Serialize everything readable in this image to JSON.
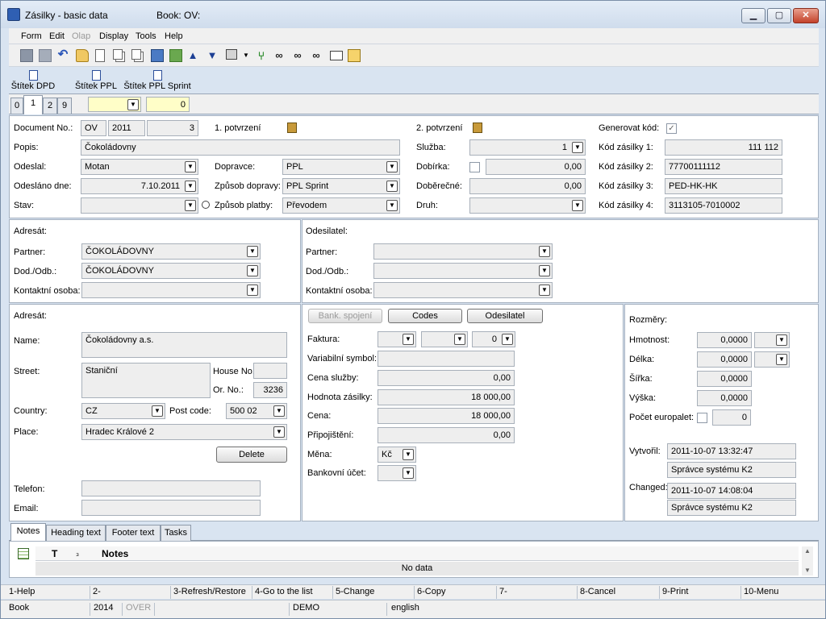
{
  "window": {
    "title": "Zásilky - basic data",
    "book_label": "Book: OV:",
    "minimize": "▁",
    "maximize": "▢",
    "close": "✕"
  },
  "menu": [
    "Form",
    "Edit",
    "Olap",
    "Display",
    "Tools",
    "Help"
  ],
  "toolbar_icons": [
    "save-icon",
    "save-all-icon",
    "undo-icon",
    "open-folder-icon",
    "new-document-icon",
    "copy-icon",
    "paste-icon",
    "book-icon",
    "stack-icon",
    "arrow-up-icon",
    "arrow-down-icon",
    "select-icon",
    "dropdown-icon",
    "fork-icon",
    "binoculars-icon",
    "binoculars-filter-icon",
    "binoculars-settings-icon",
    "mail-icon",
    "edit-icon"
  ],
  "print_buttons": [
    "Štítek DPD",
    "Štítek PPL",
    "Štítek PPL Sprint"
  ],
  "top_tabs": {
    "tabs": [
      "0",
      "1",
      "2",
      "9"
    ],
    "active": "1",
    "counter": "0"
  },
  "header": {
    "document_no_label": "Document No.:",
    "doc_prefix": "OV",
    "doc_year": "2011",
    "doc_number": "3",
    "potvrzeni1_label": "1. potvrzení",
    "potvrzeni2_label": "2. potvrzení",
    "generovat_kod_label": "Generovat kód:",
    "generovat_kod_checked": "✓",
    "popis_label": "Popis:",
    "popis_value": "Čokoládovny",
    "sluzba_label": "Služba:",
    "sluzba_value": "1",
    "kod1_label": "Kód zásilky 1:",
    "kod1_value": "111 112",
    "odeslal_label": "Odeslal:",
    "odeslal_value": "Motan",
    "dopravce_label": "Dopravce:",
    "dopravce_value": "PPL",
    "dobirka_label": "Dobírka:",
    "dobirka_value": "0,00",
    "kod2_label": "Kód zásilky 2:",
    "kod2_value": "77700111112",
    "odeslano_label": "Odesláno dne:",
    "odeslano_value": "7.10.2011",
    "zpusob_dopravy_label": "Způsob dopravy:",
    "zpusob_dopravy_value": "PPL Sprint",
    "doberecne_label": "Doběrečné:",
    "doberecne_value": "0,00",
    "kod3_label": "Kód zásilky 3:",
    "kod3_value": "PED-HK-HK",
    "stav_label": "Stav:",
    "stav_value": "",
    "zpusob_platby_label": "Způsob platby:",
    "zpusob_platby_value": "Převodem",
    "druh_label": "Druh:",
    "druh_value": "",
    "kod4_label": "Kód zásilky 4:",
    "kod4_value": "3113105-7010002"
  },
  "adresat": {
    "title": "Adresát:",
    "partner_label": "Partner:",
    "partner_value": "ČOKOLÁDOVNY",
    "dod_label": "Dod./Odb.:",
    "dod_value": "ČOKOLÁDOVNY",
    "kontakt_label": "Kontaktní osoba:",
    "kontakt_value": ""
  },
  "odesilatel": {
    "title": "Odesilatel:",
    "partner_label": "Partner:",
    "partner_value": "",
    "dod_label": "Dod./Odb.:",
    "dod_value": "",
    "kontakt_label": "Kontaktní osoba:",
    "kontakt_value": ""
  },
  "address": {
    "title": "Adresát:",
    "name_label": "Name:",
    "name_value": "Čokoládovny a.s.",
    "street_label": "Street:",
    "street_value": "Staniční",
    "house_no_label": "House No.",
    "house_no_value": "",
    "or_no_label": "Or. No.:",
    "or_no_value": "3236",
    "country_label": "Country:",
    "country_value": "CZ",
    "post_code_label": "Post code:",
    "post_code_value": "500 02",
    "place_label": "Place:",
    "place_value": "Hradec Králové 2",
    "delete_label": "Delete",
    "telefon_label": "Telefon:",
    "telefon_value": "",
    "email_label": "Email:",
    "email_value": ""
  },
  "billing": {
    "bank_spojeni_label": "Bank. spojení",
    "codes_label": "Codes",
    "odesilatel_label": "Odesilatel",
    "faktura_label": "Faktura:",
    "faktura_num": "0",
    "variabilni_label": "Variabilní symbol:",
    "variabilni_value": "",
    "cena_sluzby_label": "Cena služby:",
    "cena_sluzby_value": "0,00",
    "hodnota_label": "Hodnota zásilky:",
    "hodnota_value": "18 000,00",
    "cena_label": "Cena:",
    "cena_value": "18 000,00",
    "pripojisteni_label": "Připojištění:",
    "pripojisteni_value": "0,00",
    "mena_label": "Měna:",
    "mena_value": "Kč",
    "bankovni_label": "Bankovní účet:",
    "bankovni_value": ""
  },
  "dimensions": {
    "title": "Rozměry:",
    "hmotnost_label": "Hmotnost:",
    "hmotnost_value": "0,0000",
    "delka_label": "Délka:",
    "delka_value": "0,0000",
    "sirka_label": "Šířka:",
    "sirka_value": "0,0000",
    "vyska_label": "Výška:",
    "vyska_value": "0,0000",
    "europalet_label": "Počet europalet:",
    "europalet_value": "0",
    "vytvoril_label": "Vytvořil:",
    "vytvoril_date": "2011-10-07 13:32:47",
    "vytvoril_user": "Správce systému K2",
    "changed_label": "Changed:",
    "changed_date": "2011-10-07 14:08:04",
    "changed_user": "Správce systému K2"
  },
  "bottom_tabs": {
    "tabs": [
      "Notes",
      "Heading text",
      "Footer text",
      "Tasks"
    ],
    "active": "Notes",
    "col_t": "T",
    "col_sub": "₃",
    "col_notes": "Notes",
    "no_data": "No data"
  },
  "fkeys": [
    "1-Help",
    "2-",
    "3-Refresh/Restore",
    "4-Go to the list",
    "5-Change",
    "6-Copy",
    "7-",
    "8-Cancel",
    "9-Print",
    "10-Menu"
  ],
  "status": {
    "book": "Book",
    "year": "2014",
    "over": "OVER",
    "demo": "DEMO",
    "lang": "english"
  }
}
